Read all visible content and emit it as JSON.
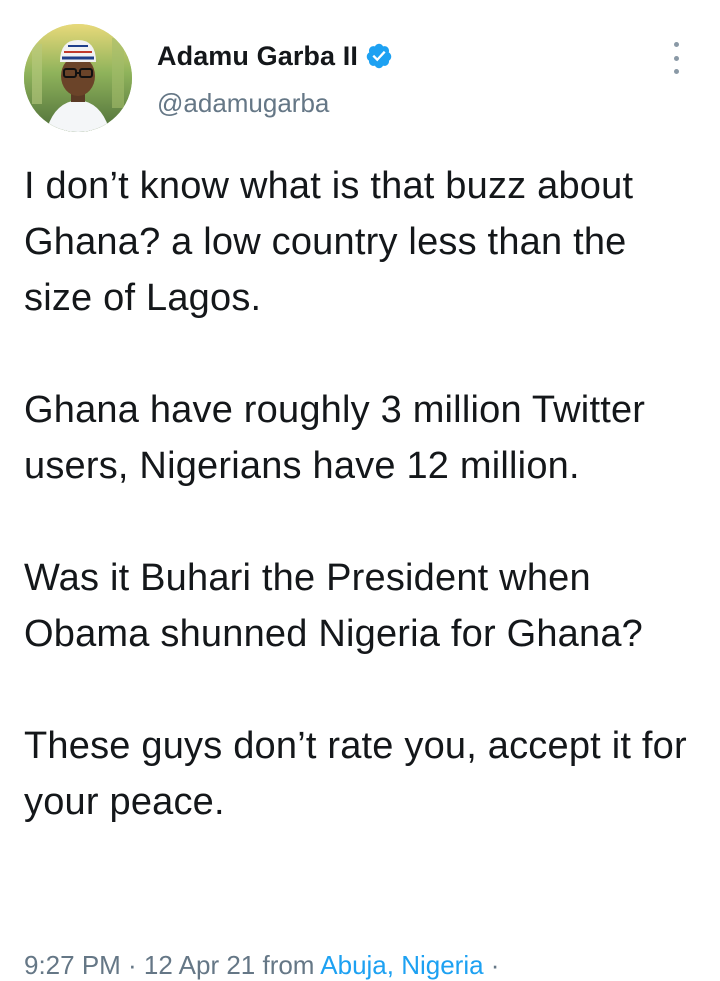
{
  "author": {
    "display_name": "Adamu Garba II",
    "handle": "@adamugarba",
    "verified": true,
    "verified_color": "#1da1f2"
  },
  "tweet": {
    "paragraphs": [
      "I don’t know what is that buzz about Ghana? a low country less than the size of Lagos.",
      "Ghana have roughly 3 million Twitter users, Nigerians have 12 million.",
      "Was it Buhari the President when Obama shunned Nigeria for Ghana?",
      "These guys don’t rate you, accept it for your peace."
    ]
  },
  "meta": {
    "time_date": "9:27 PM · 12 Apr 21 from ",
    "location": "Abuja, Nigeria",
    "separator": " ·"
  },
  "icons": {
    "more": "more-vertical-icon",
    "verified": "verified-badge-icon"
  }
}
